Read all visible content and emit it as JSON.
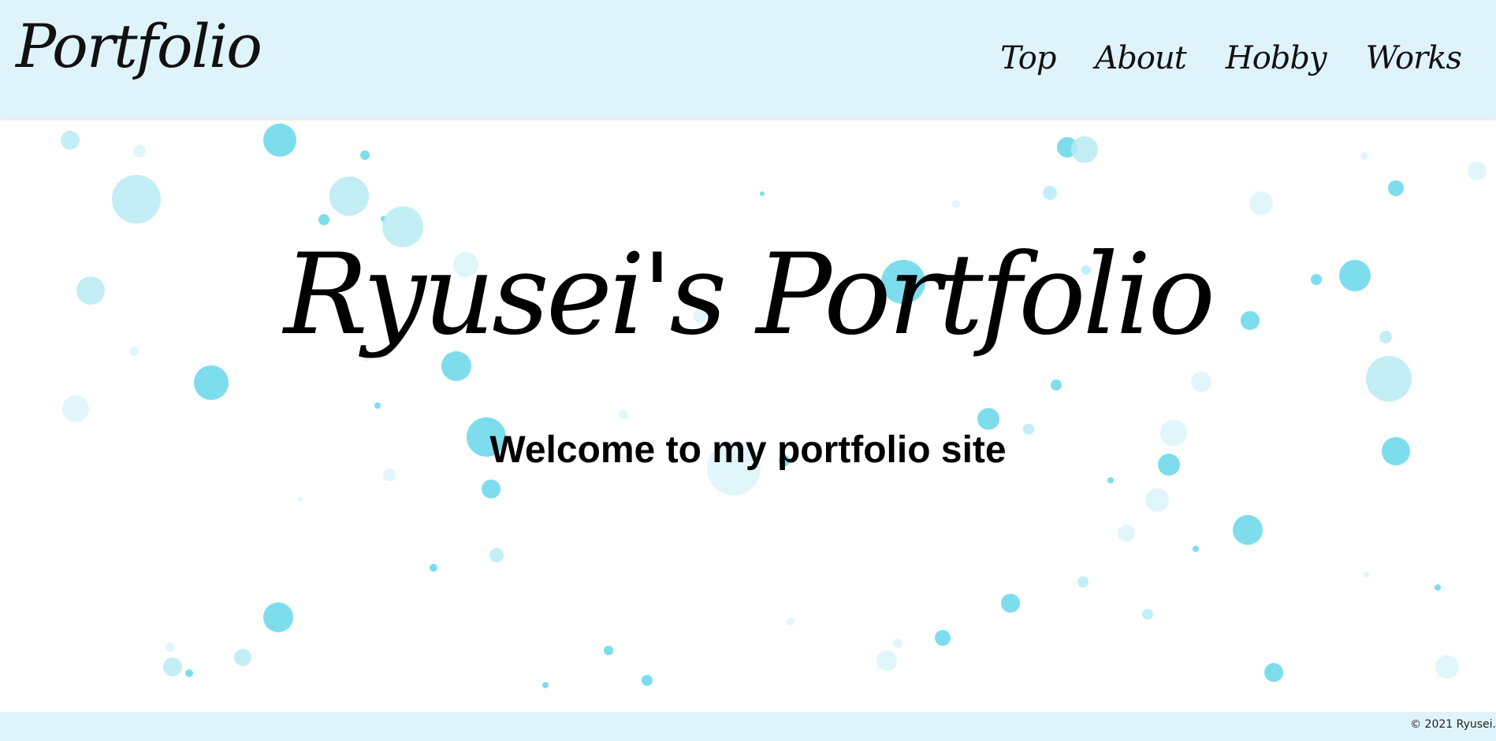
{
  "header": {
    "logo": "Portfolio",
    "nav": [
      {
        "label": "Top"
      },
      {
        "label": "About"
      },
      {
        "label": "Hobby"
      },
      {
        "label": "Works"
      }
    ]
  },
  "hero": {
    "title": "Ryusei's Portfolio",
    "subtitle": "Welcome to my portfolio site"
  },
  "footer": {
    "copyright": "© 2021 Ryusei."
  },
  "colors": {
    "header_bg": "#dff3fb",
    "bubble_dark": "#5dd5e8",
    "bubble_light": "#b9ebf4",
    "bubble_pale": "#dcf5fa"
  }
}
